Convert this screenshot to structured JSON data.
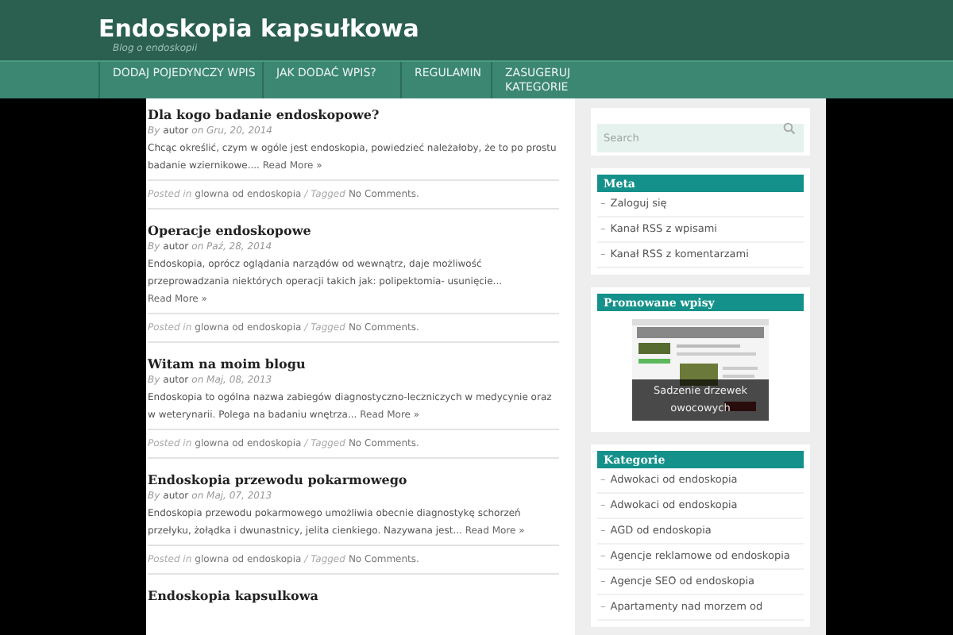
{
  "site": {
    "title": "Endoskopia kapsułkowa",
    "tagline": "Blog o endoskopii"
  },
  "nav": [
    {
      "label": "DODAJ POJEDYNCZY WPIS"
    },
    {
      "label": "JAK DODAĆ WPIS?"
    },
    {
      "label": "REGULAMIN"
    },
    {
      "label": "ZASUGERUJ KATEGORIE"
    }
  ],
  "posts": [
    {
      "title": "Dla kogo badanie endoskopowe?",
      "by": "By",
      "author": "autor",
      "date": "on Gru, 20, 2014",
      "excerpt": "Chcąc określić, czym w ogóle jest endoskopia, powiedzieć należałoby, że to po prostu badanie wziernikowe....",
      "read_more": "Read More »",
      "posted_in": "Posted in",
      "category": "glowna od endoskopia",
      "tagged": "/ Tagged",
      "comments": "No Comments."
    },
    {
      "title": "Operacje endoskopowe",
      "by": "By",
      "author": "autor",
      "date": "on Paź, 28, 2014",
      "excerpt": "Endoskopia, oprócz oglądania narządów od wewnątrz, daje możliwość przeprowadzania niektórych operacji takich jak: polipektomia- usunięcie...",
      "read_more": "Read More »",
      "posted_in": "Posted in",
      "category": "glowna od endoskopia",
      "tagged": "/ Tagged",
      "comments": "No Comments."
    },
    {
      "title": "Witam na moim blogu",
      "by": "By",
      "author": "autor",
      "date": "on Maj, 08, 2013",
      "excerpt": "Endoskopia to ogólna nazwa zabiegów diagnostyczno-leczniczych w medycynie oraz w weterynarii. Polega na badaniu wnętrza...",
      "read_more": "Read More »",
      "posted_in": "Posted in",
      "category": "glowna od endoskopia",
      "tagged": "/ Tagged",
      "comments": "No Comments."
    },
    {
      "title": "Endoskopia przewodu pokarmowego",
      "by": "By",
      "author": "autor",
      "date": "on Maj, 07, 2013",
      "excerpt": "Endoskopia przewodu pokarmowego umożliwia obecnie diagnostykę schorzeń przełyku, żołądka i dwunastnicy, jelita cienkiego. Nazywana jest...",
      "read_more": "Read More »",
      "posted_in": "Posted in",
      "category": "glowna od endoskopia",
      "tagged": "/ Tagged",
      "comments": "No Comments."
    },
    {
      "title": "Endoskopia kapsulkowa"
    }
  ],
  "sidebar": {
    "search": {
      "placeholder": "Search"
    },
    "widgets": [
      {
        "kind": "list",
        "title": "Meta",
        "bullet": "–",
        "items": [
          "Zaloguj się",
          "Kanał RSS z wpisami",
          "Kanał RSS z komentarzami"
        ]
      },
      {
        "kind": "promo",
        "title": "Promowane wpisy",
        "caption": "Sadzenie drzewek owocowych"
      },
      {
        "kind": "list",
        "title": "Kategorie",
        "bullet": "–",
        "items": [
          "Adwokaci od endoskopia",
          "Adwokaci od endoskopia",
          "AGD od endoskopia",
          "Agencje reklamowe od endoskopia",
          "Agencje SEO od endoskopia",
          "Apartamenty nad morzem od"
        ]
      }
    ]
  }
}
